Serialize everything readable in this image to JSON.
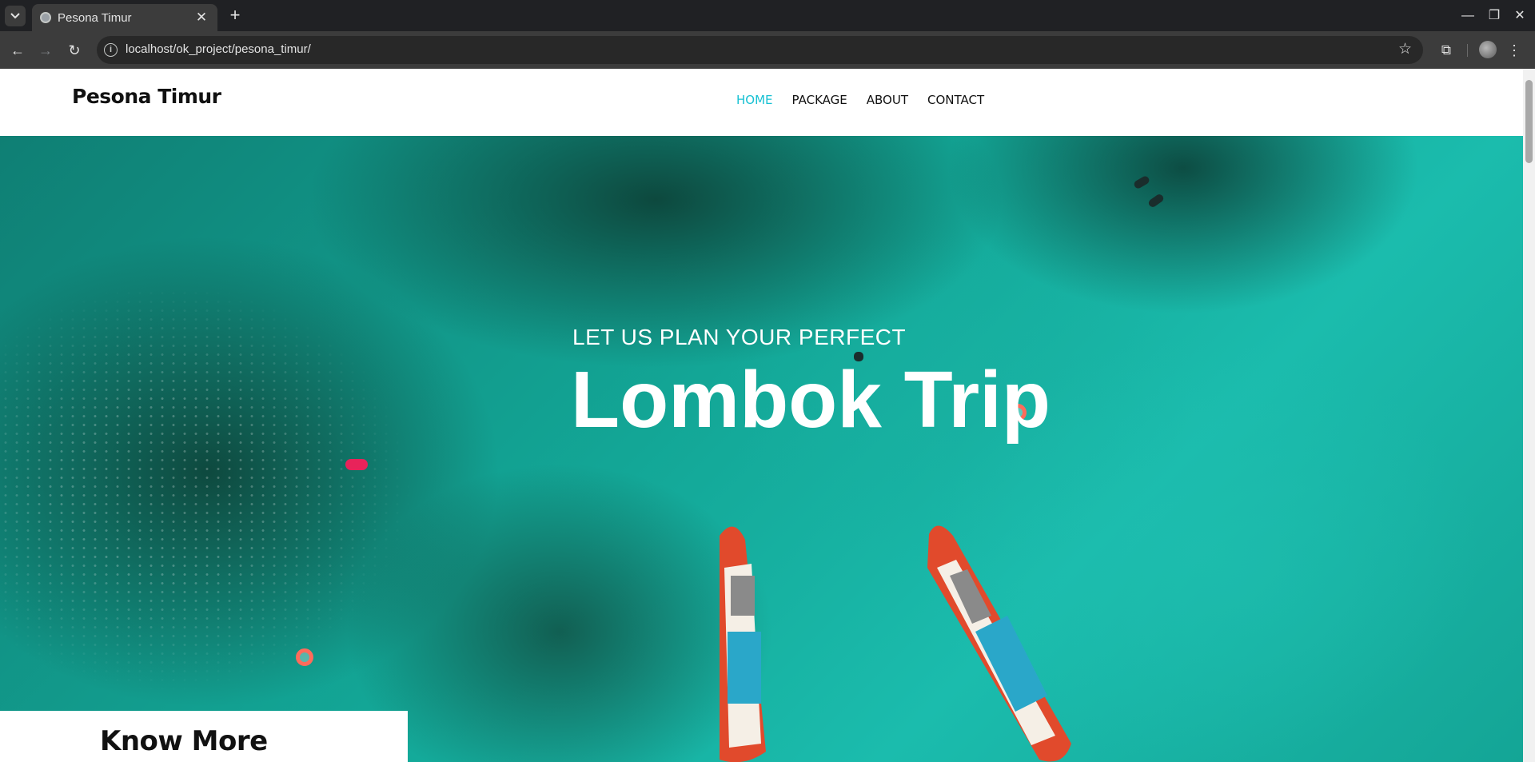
{
  "browser": {
    "tab_title": "Pesona Timur",
    "url": "localhost/ok_project/pesona_timur/"
  },
  "site": {
    "brand": "Pesona Timur",
    "nav": [
      {
        "label": "HOME",
        "active": true
      },
      {
        "label": "PACKAGE",
        "active": false
      },
      {
        "label": "ABOUT",
        "active": false
      },
      {
        "label": "CONTACT",
        "active": false
      }
    ],
    "accent_color": "#17c1d3"
  },
  "hero": {
    "subtitle": "LET US PLAN YOUR PERFECT",
    "title": "Lombok Trip"
  },
  "know_more": {
    "title": "Know More"
  }
}
